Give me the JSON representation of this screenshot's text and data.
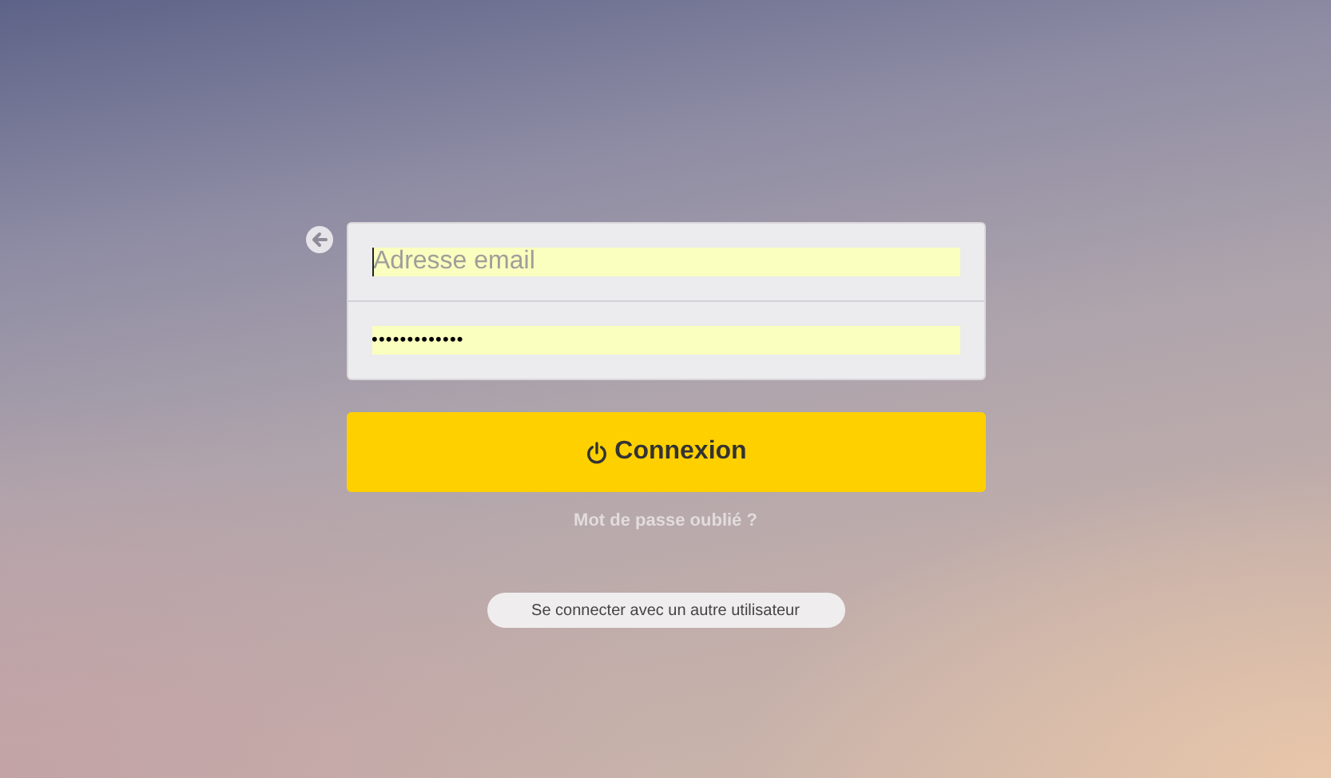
{
  "login_form": {
    "email": {
      "placeholder": "Adresse email"
    },
    "password": {
      "value": "•••••••••••••"
    }
  },
  "connect_button": {
    "label": "Connexion"
  },
  "forgot_password_link": "Mot de passe oublié ?",
  "other_user_button": "Se connecter avec un autre utilisateur"
}
